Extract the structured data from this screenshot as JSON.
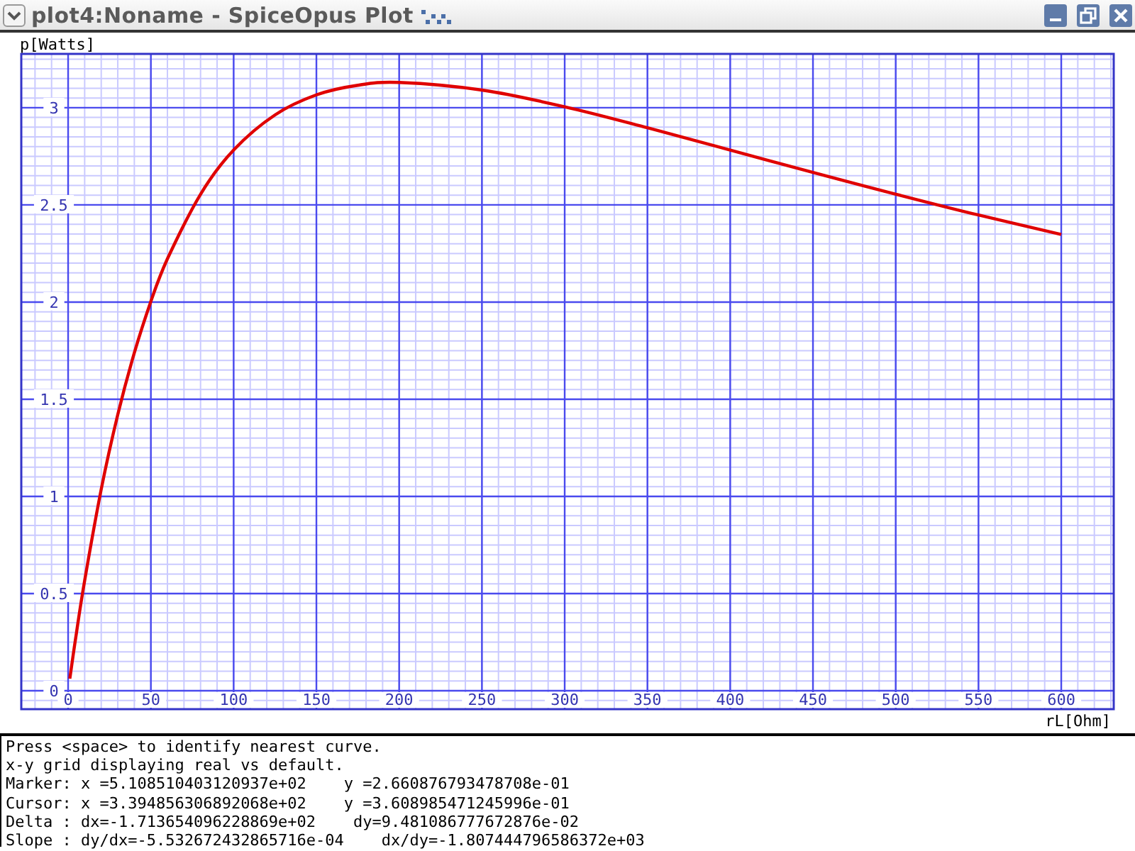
{
  "window": {
    "title": "plot4:Noname - SpiceOpus Plot"
  },
  "plot": {
    "chart_data": {
      "type": "line",
      "xlabel": "rL[Ohm]",
      "ylabel": "p[Watts]",
      "x": [
        1,
        5,
        10,
        20,
        30,
        40,
        50,
        60,
        80,
        100,
        125,
        150,
        175,
        200,
        250,
        300,
        350,
        400,
        450,
        500,
        550,
        600
      ],
      "series": [
        {
          "color": "#e00000",
          "values": [
            0.062,
            0.298,
            0.568,
            1.035,
            1.42,
            1.739,
            2.003,
            2.222,
            2.555,
            2.782,
            2.963,
            3.066,
            3.116,
            3.13,
            3.091,
            3.005,
            2.897,
            2.782,
            2.667,
            2.555,
            2.448,
            2.348
          ]
        }
      ],
      "xlim": [
        -28.3,
        631.7
      ],
      "ylim": [
        -0.095,
        3.277
      ],
      "xticks": [
        0,
        50,
        100,
        150,
        200,
        250,
        300,
        350,
        400,
        450,
        500,
        550,
        600
      ],
      "yticks": [
        0,
        0.5,
        1,
        1.5,
        2,
        2.5,
        3
      ],
      "grid": true
    }
  },
  "info": {
    "lines": [
      "Press <space> to identify nearest curve.",
      "x-y grid displaying real vs default.",
      "Marker: x =5.108510403120937e+02    y =2.660876793478708e-01",
      "Cursor: x =3.394856306892068e+02    y =3.608985471245996e-01",
      "Delta : dx=-1.713654096228869e+02    dy=9.481086777672876e-02",
      "Slope : dy/dx=-5.532672432865716e-04    dx/dy=-1.807444796586372e+03"
    ]
  }
}
